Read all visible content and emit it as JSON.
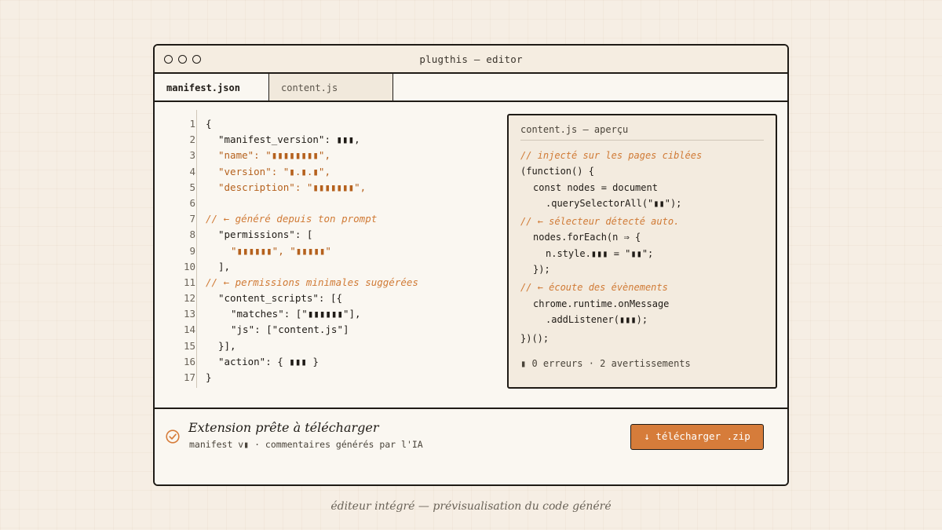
{
  "window": {
    "title": "plugthis — editor"
  },
  "tabs": [
    {
      "label": "manifest.json",
      "active": true
    },
    {
      "label": "content.js",
      "active": false
    }
  ],
  "editor": {
    "line_numbers": [
      "1",
      "2",
      "3",
      "4",
      "5",
      "6",
      "7",
      "8",
      "9",
      "10",
      "11",
      "12",
      "13",
      "14",
      "15",
      "16",
      "17"
    ],
    "lines": [
      "{",
      "\"manifest_version\": ▮▮▮,",
      "\"name\": \"▮▮▮▮▮▮▮▮\",",
      "\"version\": \"▮.▮.▮\",",
      "\"description\": \"▮▮▮▮▮▮▮\",",
      "// ← généré depuis ton prompt",
      "\"permissions\": [",
      "\"▮▮▮▮▮▮\", \"▮▮▮▮▮\"",
      "],",
      "// ← permissions minimales suggérées",
      "\"content_scripts\": [{",
      "\"matches\": [\"▮▮▮▮▮▮\"],",
      "\"js\": [\"content.js\"]",
      "}],",
      "\"action\": { ▮▮▮ }",
      "}"
    ]
  },
  "preview": {
    "header": "content.js — aperçu",
    "lines": [
      "// injecté sur les pages ciblées",
      "(function() {",
      "const nodes = document",
      ".querySelectorAll(\"▮▮\");",
      "// ← sélecteur détecté auto.",
      "nodes.forEach(n ⇒ {",
      "n.style.▮▮▮ = \"▮▮\";",
      "});",
      "// ← écoute des évènements",
      "chrome.runtime.onMessage",
      ".addListener(▮▮▮);",
      "})();"
    ],
    "status": "▮ 0 erreurs · 2 avertissements"
  },
  "footer": {
    "title": "Extension prête à télécharger",
    "subtitle": "manifest v▮ · commentaires générés par l'IA",
    "download_label": "↓ télécharger .zip"
  },
  "caption": "éditeur intégré — prévisualisation du code généré",
  "colors": {
    "accent": "#d67c3a",
    "string": "#b5611d",
    "background": "#f6eee4"
  },
  "icons": {
    "ready": "check-circle-icon"
  }
}
